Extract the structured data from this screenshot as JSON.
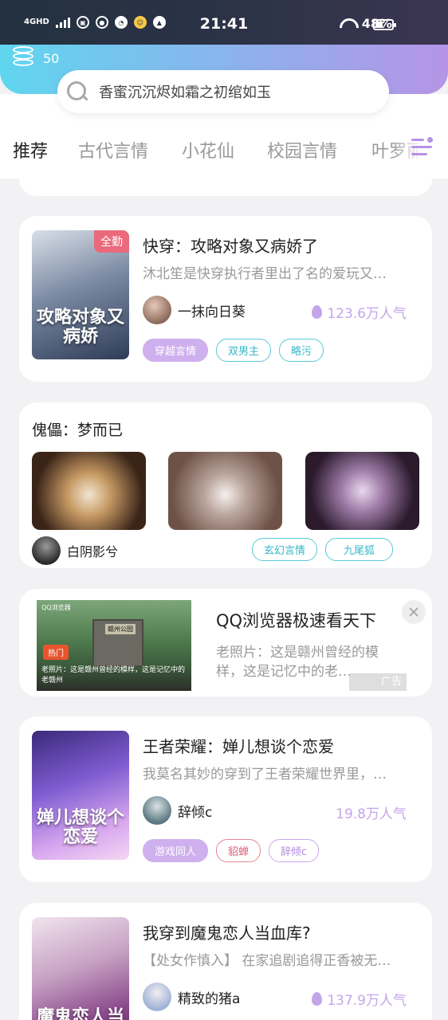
{
  "status_bar": {
    "network": "4GHD",
    "time": "21:41",
    "battery": "48%",
    "app_icons": [
      "photo-icon",
      "wechat-icon",
      "clock-icon",
      "face-icon",
      "fire-icon"
    ]
  },
  "header": {
    "coins": "50",
    "search_placeholder": "香蜜沉沉烬如霜之初绾如玉"
  },
  "tabs": [
    "推荐",
    "古代言情",
    "小花仙",
    "校园言情",
    "叶罗丽精"
  ],
  "books": [
    {
      "title": "快穿：攻略对象又病娇了",
      "desc": "沐北笙是快穿执行者里出了名的爱玩又…",
      "author": "一抹向日葵",
      "heat": "123.6万人气",
      "badge": "全勤",
      "cover_text": "攻略对象又病娇",
      "tags": [
        "穿越言情",
        "双男主",
        "略污"
      ]
    },
    {
      "title": "王者荣耀：婵儿想谈个恋爱",
      "desc": "我莫名其妙的穿到了王者荣耀世界里，…",
      "author": "辞倾c",
      "heat": "19.8万人气",
      "cover_text": "婵儿想谈个恋爱",
      "tags": [
        "游戏同人",
        "貂蝉",
        "辞倾c"
      ]
    },
    {
      "title": "我穿到魔鬼恋人当血库?",
      "desc": "【处女作慎入】 在家追剧追得正香被无…",
      "author": "精致的猪a",
      "heat": "137.9万人气",
      "cover_text": "魔鬼恋人当血库",
      "tags": []
    }
  ],
  "collection": {
    "title": "傀儡：梦而已",
    "author": "白阴影兮",
    "tags": [
      "玄幻言情",
      "九尾狐"
    ]
  },
  "ad": {
    "title": "QQ浏览器极速看天下",
    "desc": "老照片：这是赣州曾经的模样，这是记忆中的老…",
    "hot_label": "热门",
    "caption": "老照片：这是赣州曾经的模样，这是记忆中的老赣州",
    "brand": "QQ浏览器",
    "gate_label": "赣州公园",
    "ad_label": "广告"
  },
  "colors": {
    "accent": "#c9a6ee",
    "heat": "#c4a5ea",
    "badge": "#ea6a7b",
    "teal_tag": "#35b8c9"
  }
}
